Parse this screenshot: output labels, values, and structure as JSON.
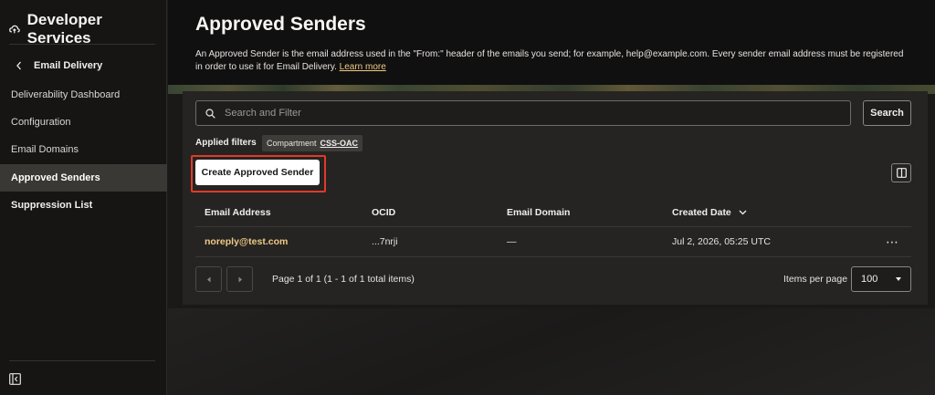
{
  "sidebar": {
    "title": "Developer Services",
    "back_label": "Email Delivery",
    "items": [
      {
        "label": "Deliverability Dashboard"
      },
      {
        "label": "Configuration"
      },
      {
        "label": "Email Domains"
      },
      {
        "label": "Approved Senders"
      },
      {
        "label": "Suppression List"
      }
    ],
    "active_item": "Approved Senders"
  },
  "header": {
    "title": "Approved Senders",
    "description": "An Approved Sender is the email address used in the \"From:\" header of the emails you send; for example, help@example.com. Every sender email address must be registered in order to use it for Email Delivery.",
    "learn_more": "Learn more"
  },
  "search": {
    "placeholder": "Search and Filter",
    "button_label": "Search"
  },
  "filters": {
    "label": "Applied filters",
    "chip_key": "Compartment",
    "chip_value": "CSS-OAC"
  },
  "actions": {
    "create_label": "Create Approved Sender"
  },
  "table": {
    "columns": [
      "Email Address",
      "OCID",
      "Email Domain",
      "Created Date"
    ],
    "sorted_column": "Created Date",
    "rows": [
      {
        "email": "noreply@test.com",
        "ocid": "...7nrji",
        "domain": "—",
        "created": "Jul 2, 2026, 05:25 UTC",
        "actions": "⋯"
      }
    ]
  },
  "pagination": {
    "page_info": "Page 1 of 1 (1 - 1 of 1 total items)",
    "items_per_page_label": "Items per page",
    "items_per_page_value": "100"
  },
  "colors": {
    "accent_link": "#f0c985",
    "highlight_border": "#e03a2a",
    "active_nav_bg": "#3a3835"
  }
}
